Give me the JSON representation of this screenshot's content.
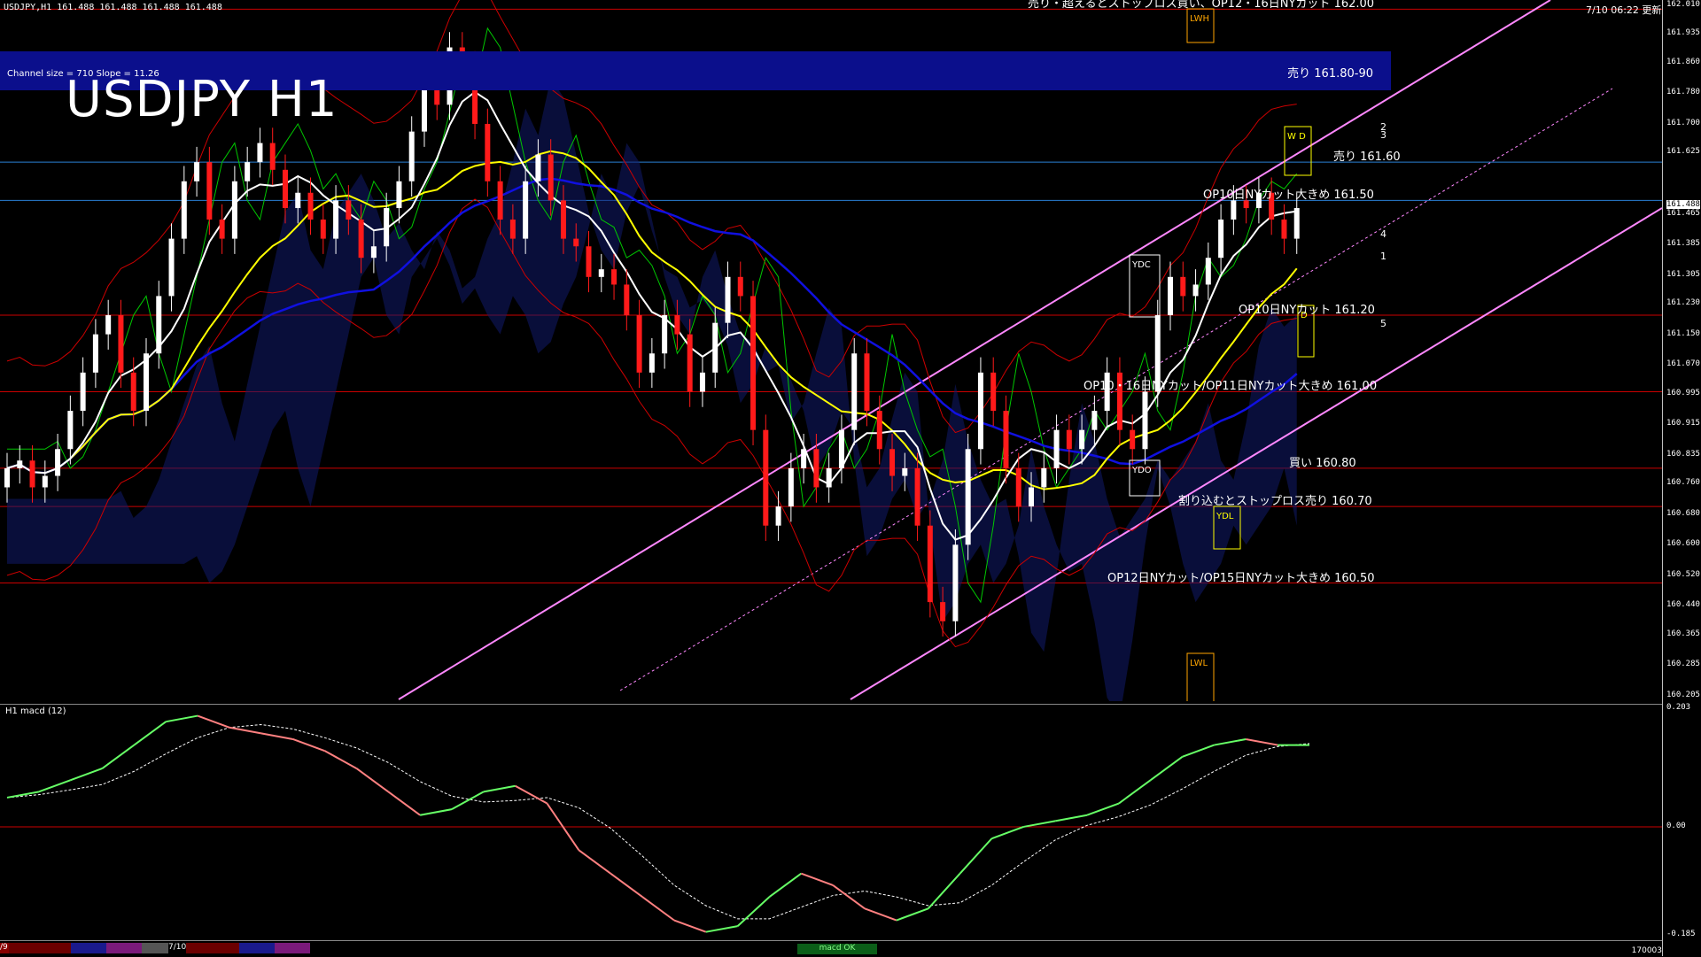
{
  "header": {
    "ohlc_text": "USDJPY,H1  161.488 161.488 161.488 161.488",
    "timestamp": "7/10 06:22 更新",
    "big_title": "USDJPY H1",
    "channel_info": "Channel size = 710 Slope = 11.26"
  },
  "sell_band": {
    "label": "売り 161.80-90"
  },
  "level_labels": [
    {
      "text": "売り・超えるとストップロス買い、OP12・16日NYカット 162.00",
      "price": 162.0
    },
    {
      "text": "売り 161.60",
      "price": 161.6
    },
    {
      "text": "OP10日NYカット大きめ 161.50",
      "price": 161.5
    },
    {
      "text": "OP10日NYカット 161.20",
      "price": 161.2
    },
    {
      "text": "OP10・16日NYカット/OP11日NYカット大きめ 161.00",
      "price": 161.0
    },
    {
      "text": "買い 160.80",
      "price": 160.8
    },
    {
      "text": "割り込むとストップロス売り 160.70",
      "price": 160.7
    },
    {
      "text": "OP12日NYカット/OP15日NYカット大きめ 160.50",
      "price": 160.5
    }
  ],
  "price_axis": {
    "labels": [
      "162.010",
      "161.935",
      "161.860",
      "161.780",
      "161.700",
      "161.625",
      "161.488",
      "161.465",
      "161.385",
      "161.305",
      "161.230",
      "161.150",
      "161.070",
      "160.995",
      "160.915",
      "160.835",
      "160.760",
      "160.680",
      "160.600",
      "160.520",
      "160.440",
      "160.365",
      "160.285",
      "160.205"
    ],
    "current_price": "161.488"
  },
  "macd_axis": {
    "top": "0.203",
    "zero": "0.00",
    "bottom": "-0.185"
  },
  "macd": {
    "title": "H1  macd (12)",
    "status": "macd OK",
    "right_code": "170003"
  },
  "bottom_bar": {
    "left_label": "/9",
    "date_label": "7/10"
  },
  "markers": {
    "ydc": "YDC",
    "ydo": "YDO",
    "ydl": "YDL",
    "lwh": "LWH",
    "lwl": "LWL",
    "m": "M",
    "w": "W",
    "d": "D",
    "wd": "W D",
    "mw": "M W"
  },
  "channel_tags": [
    "2",
    "3",
    "4",
    "1",
    "5"
  ],
  "colors": {
    "bull": "#ffffff",
    "bear": "#ff1a1a",
    "ma_white": "#ffffff",
    "ma_yellow": "#ffff00",
    "ma_blue": "#1010e0",
    "ichimoku_green": "#00c800",
    "band_red": "#cc0000",
    "channel": "#ff88ff",
    "macd_main": "#66ff66",
    "macd_neg": "#ff8080",
    "macd_signal": "#ffffff",
    "level_line": "#cc0000",
    "blue_line": "#2a7fd4",
    "sell_band": "#0b0f8c"
  },
  "chart_data": {
    "type": "candlestick",
    "symbol": "USDJPY",
    "timeframe": "H1",
    "ylim": [
      160.205,
      162.01
    ],
    "close": [
      160.8,
      160.82,
      160.75,
      160.78,
      160.85,
      160.95,
      161.05,
      161.15,
      161.2,
      161.05,
      160.95,
      161.1,
      161.25,
      161.4,
      161.55,
      161.6,
      161.45,
      161.4,
      161.55,
      161.6,
      161.65,
      161.58,
      161.48,
      161.52,
      161.45,
      161.4,
      161.5,
      161.45,
      161.35,
      161.38,
      161.48,
      161.55,
      161.68,
      161.82,
      161.75,
      161.9,
      161.85,
      161.7,
      161.55,
      161.45,
      161.4,
      161.55,
      161.62,
      161.5,
      161.4,
      161.38,
      161.3,
      161.32,
      161.28,
      161.2,
      161.05,
      161.1,
      161.2,
      161.15,
      161.0,
      161.05,
      161.18,
      161.3,
      161.25,
      160.9,
      160.65,
      160.7,
      160.8,
      160.85,
      160.75,
      160.8,
      160.9,
      161.1,
      160.95,
      160.85,
      160.78,
      160.8,
      160.65,
      160.45,
      160.4,
      160.6,
      160.85,
      161.05,
      160.95,
      160.8,
      160.7,
      160.75,
      160.8,
      160.9,
      160.85,
      160.9,
      160.95,
      161.05,
      160.9,
      160.85,
      161.0,
      161.2,
      161.3,
      161.25,
      161.28,
      161.35,
      161.45,
      161.5,
      161.48,
      161.52,
      161.45,
      161.4,
      161.48
    ],
    "macd": [
      0.05,
      0.06,
      0.08,
      0.1,
      0.14,
      0.18,
      0.19,
      0.17,
      0.16,
      0.15,
      0.13,
      0.1,
      0.06,
      0.02,
      0.03,
      0.06,
      0.07,
      0.04,
      -0.04,
      -0.08,
      -0.12,
      -0.16,
      -0.18,
      -0.17,
      -0.12,
      -0.08,
      -0.1,
      -0.14,
      -0.16,
      -0.14,
      -0.08,
      -0.02,
      0.0,
      0.01,
      0.02,
      0.04,
      0.08,
      0.12,
      0.14,
      0.15,
      0.14,
      0.14
    ]
  }
}
